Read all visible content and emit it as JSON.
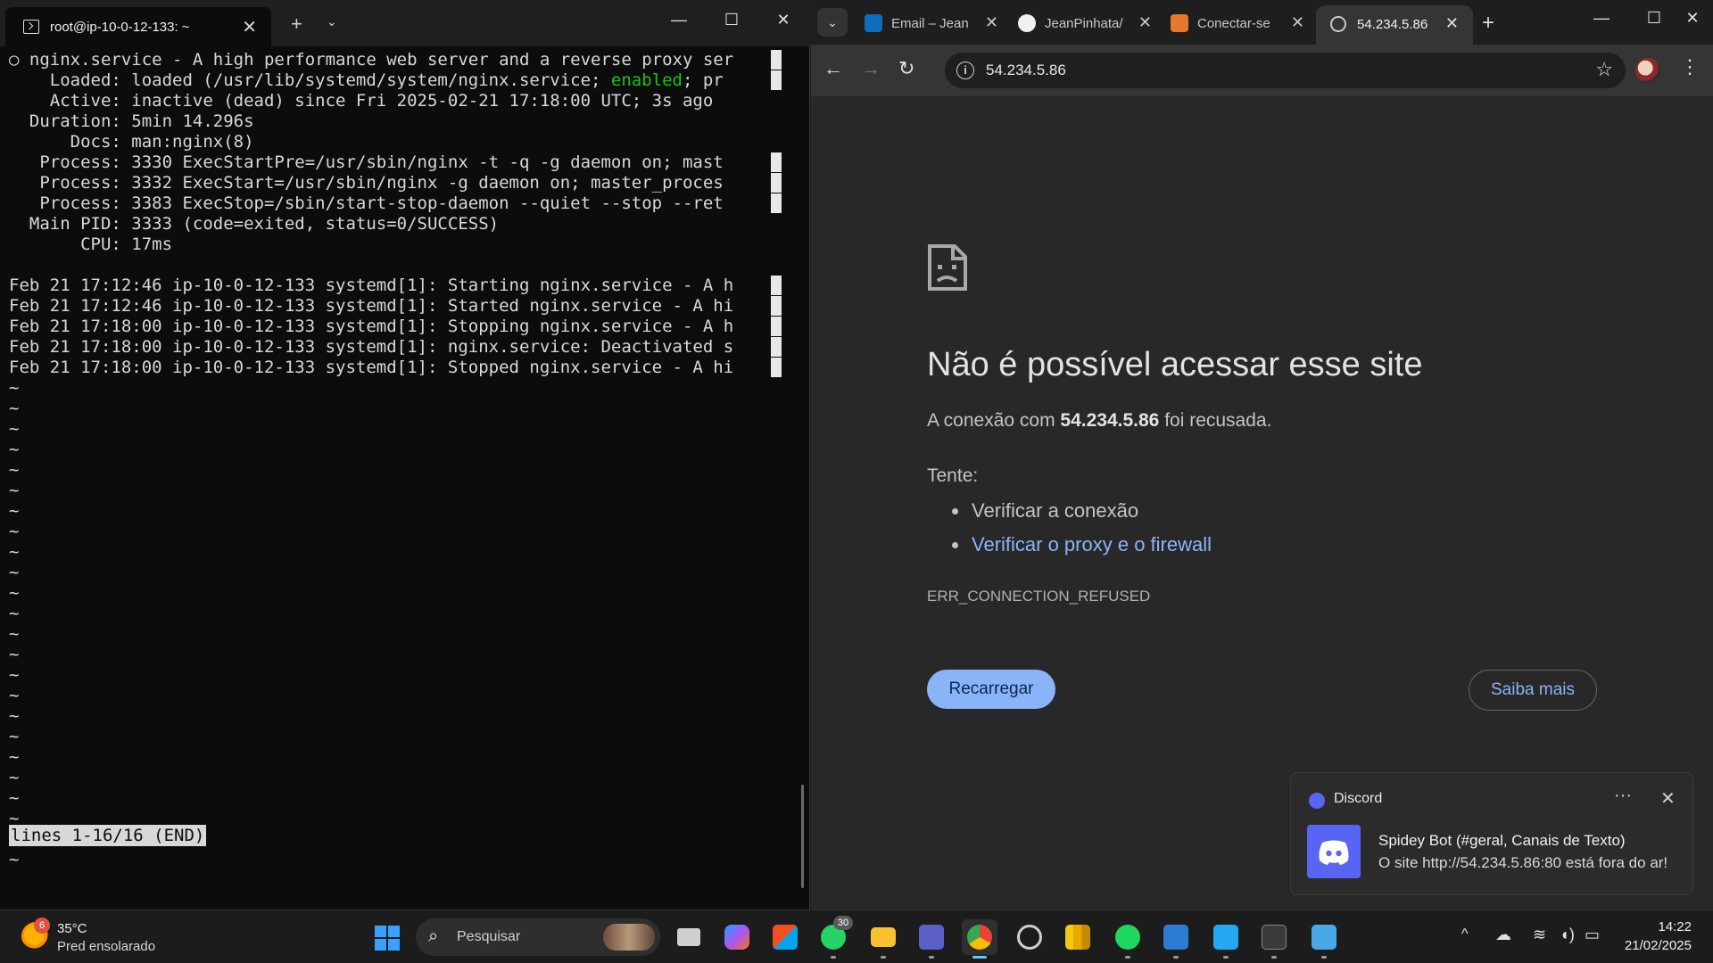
{
  "terminal": {
    "tab_title": "root@ip-10-0-12-133: ~",
    "lines": [
      {
        "text": "○ nginx.service - A high performance web server and a reverse proxy ser",
        "cursor": true
      },
      {
        "pre": "    Loaded: loaded (/usr/lib/systemd/system/nginx.service; ",
        "green": "enabled",
        "post": "; pr",
        "cursor": true
      },
      {
        "text": "    Active: inactive (dead) since Fri 2025-02-21 17:18:00 UTC; 3s ago"
      },
      {
        "text": "  Duration: 5min 14.296s"
      },
      {
        "text": "      Docs: man:nginx(8)"
      },
      {
        "text": "   Process: 3330 ExecStartPre=/usr/sbin/nginx -t -q -g daemon on; mast",
        "cursor": true
      },
      {
        "text": "   Process: 3332 ExecStart=/usr/sbin/nginx -g daemon on; master_proces",
        "cursor": true
      },
      {
        "text": "   Process: 3383 ExecStop=/sbin/start-stop-daemon --quiet --stop --ret",
        "cursor": true
      },
      {
        "text": "  Main PID: 3333 (code=exited, status=0/SUCCESS)"
      },
      {
        "text": "       CPU: 17ms"
      },
      {
        "text": ""
      },
      {
        "text": "Feb 21 17:12:46 ip-10-0-12-133 systemd[1]: Starting nginx.service - A h",
        "cursor": true
      },
      {
        "text": "Feb 21 17:12:46 ip-10-0-12-133 systemd[1]: Started nginx.service - A hi",
        "cursor": true
      },
      {
        "text": "Feb 21 17:18:00 ip-10-0-12-133 systemd[1]: Stopping nginx.service - A h",
        "cursor": true
      },
      {
        "text": "Feb 21 17:18:00 ip-10-0-12-133 systemd[1]: nginx.service: Deactivated s",
        "cursor": true
      },
      {
        "text": "Feb 21 17:18:00 ip-10-0-12-133 systemd[1]: Stopped nginx.service - A hi",
        "cursor": true
      }
    ],
    "tilde": "~",
    "status": "lines 1-16/16 (END)"
  },
  "browser": {
    "tabs": [
      {
        "title": "Email – Jean",
        "color": "#0f6cbd"
      },
      {
        "title": "JeanPinhata/",
        "color": "#f0f0f0"
      },
      {
        "title": "Conectar-se",
        "color": "#e8772e"
      }
    ],
    "active_tab": "54.234.5.86",
    "url": "54.234.5.86",
    "error": {
      "title": "Não é possível acessar esse site",
      "desc_pre": "A conexão com ",
      "desc_host": "54.234.5.86",
      "desc_post": " foi recusada.",
      "try_label": "Tente:",
      "suggestions": [
        "Verificar a conexão",
        "Verificar o proxy e o firewall"
      ],
      "code": "ERR_CONNECTION_REFUSED",
      "reload_label": "Recarregar",
      "learn_label": "Saiba mais"
    }
  },
  "notification": {
    "app": "Discord",
    "title": "Spidey Bot (#geral, Canais de Texto)",
    "body": "O site http://54.234.5.86:80 está fora do ar!"
  },
  "taskbar": {
    "weather_badge": "6",
    "temperature": "35°C",
    "weather": "Pred ensolarado",
    "search_placeholder": "Pesquisar",
    "whatsapp_badge": "30",
    "time": "14:22",
    "date": "21/02/2025"
  }
}
